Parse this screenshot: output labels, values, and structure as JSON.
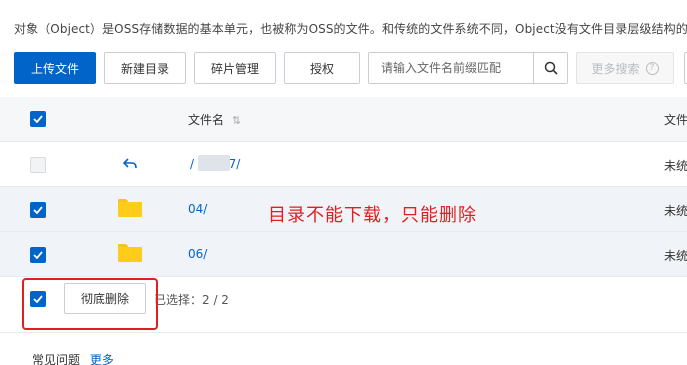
{
  "intro_text": "对象（Object）是OSS存储数据的基本单元，也被称为OSS的文件。和传统的文件系统不同，Object没有文件目录层级结构的关系",
  "toolbar": {
    "upload_label": "上传文件",
    "new_dir_label": "新建目录",
    "fragments_label": "碎片管理",
    "authorize_label": "授权",
    "search_placeholder": "请输入文件名前缀匹配",
    "more_search_label": "更多搜索"
  },
  "table": {
    "header": {
      "name_col": "文件名",
      "right_col": "文件"
    },
    "rows": [
      {
        "name": "/        /  2017/",
        "right": "未统",
        "checked": false,
        "type": "parent"
      },
      {
        "name": "04/",
        "right": "未统",
        "checked": true,
        "type": "folder"
      },
      {
        "name": "06/",
        "right": "未统",
        "checked": true,
        "type": "folder"
      }
    ],
    "footer": {
      "delete_label": "彻底删除",
      "selected_label": "已选择：2 / 2"
    }
  },
  "annotation_text": "目录不能下载，只能删除",
  "faq": {
    "title": "常见问题",
    "more": "更多"
  },
  "colors": {
    "primary": "#0064c8",
    "annotation": "#e02020",
    "folder": "#ffcc1a"
  }
}
